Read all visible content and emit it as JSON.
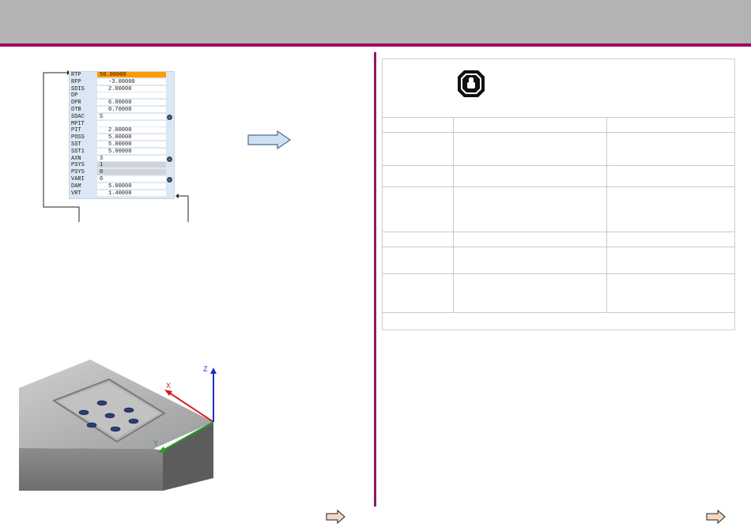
{
  "params": [
    {
      "name": "RTP",
      "value": "50.00000",
      "style": "hl",
      "toggle": false
    },
    {
      "name": "RFP",
      "value": "-3.00000",
      "style": "num",
      "toggle": false
    },
    {
      "name": "SDIS",
      "value": "2.00000",
      "style": "num",
      "toggle": false
    },
    {
      "name": "DP",
      "value": "",
      "style": "empty",
      "toggle": false
    },
    {
      "name": "DPR",
      "value": "6.00000",
      "style": "num",
      "toggle": false
    },
    {
      "name": "DTB",
      "value": "0.70000",
      "style": "num",
      "toggle": false
    },
    {
      "name": "SDAC",
      "value": "S",
      "style": "txt",
      "toggle": true
    },
    {
      "name": "MPIT",
      "value": "",
      "style": "empty",
      "toggle": false
    },
    {
      "name": "PIT",
      "value": "2.00000",
      "style": "num",
      "toggle": false
    },
    {
      "name": "POSS",
      "value": "5.00000",
      "style": "num",
      "toggle": false
    },
    {
      "name": "SST",
      "value": "5.00000",
      "style": "num",
      "toggle": false
    },
    {
      "name": "SST1",
      "value": "5.00000",
      "style": "num",
      "toggle": false
    },
    {
      "name": "AXN",
      "value": "3",
      "style": "txt",
      "toggle": true
    },
    {
      "name": "PSYS",
      "value": "1",
      "style": "gray",
      "toggle": false
    },
    {
      "name": "PSYS",
      "value": "0",
      "style": "gray",
      "toggle": false
    },
    {
      "name": "VARI",
      "value": "0",
      "style": "txt",
      "toggle": true
    },
    {
      "name": "DAM",
      "value": "5.00000",
      "style": "num",
      "toggle": false
    },
    {
      "name": "VRT",
      "value": "1.40000",
      "style": "num",
      "toggle": false
    }
  ],
  "axes": {
    "x": "X",
    "y": "Y",
    "z": "Z"
  },
  "toggle_glyph": "⌄",
  "icons": {
    "flow": "right-arrow-icon",
    "next": "next-page-arrow-icon",
    "caution": "caution-hand-icon"
  },
  "colors": {
    "title_bar": "#b3b3b3",
    "accent": "#a3005f",
    "highlight": "#ff9900",
    "panel": "#dbe7f3",
    "axis_x": "#d02020",
    "axis_y": "#20a020",
    "axis_z": "#2030c0"
  }
}
